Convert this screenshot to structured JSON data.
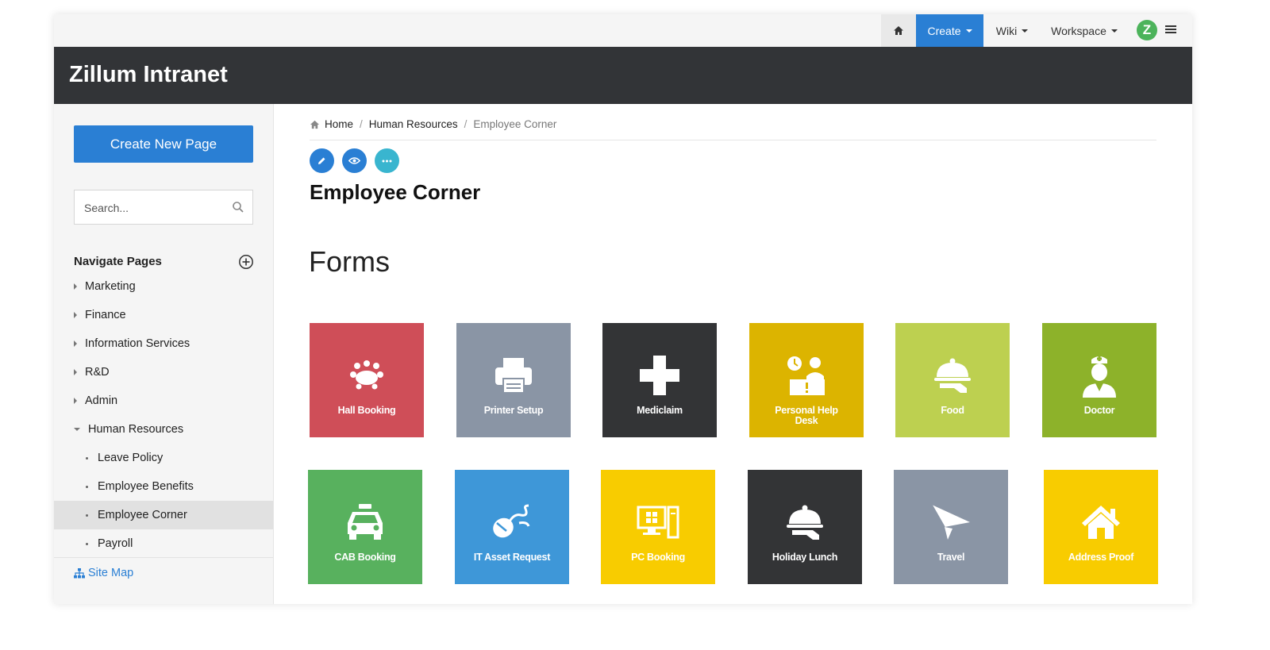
{
  "topnav": {
    "create_label": "Create",
    "wiki_label": "Wiki",
    "workspace_label": "Workspace",
    "avatar_letter": "Z",
    "icons": {
      "home": "home-icon",
      "menu": "hamburger-menu-icon"
    },
    "accent_color": "#2a7fd4"
  },
  "banner": {
    "title": "Zillum Intranet",
    "bg_color": "#323437"
  },
  "sidebar": {
    "create_button": "Create New Page",
    "search_placeholder": "Search...",
    "nav_heading": "Navigate Pages",
    "items": [
      {
        "label": "Marketing"
      },
      {
        "label": "Finance"
      },
      {
        "label": "Information Services"
      },
      {
        "label": "R&D"
      },
      {
        "label": "Admin"
      },
      {
        "label": "Human Resources",
        "expanded": true
      },
      {
        "label": "Leave Policy"
      },
      {
        "label": "Employee Benefits"
      },
      {
        "label": "Employee Corner",
        "active": true
      },
      {
        "label": "Payroll"
      }
    ],
    "sitemap_label": "Site Map"
  },
  "breadcrumb": [
    "Home",
    "Human Resources",
    "Employee Corner"
  ],
  "page": {
    "title": "Employee Corner",
    "section_title": "Forms",
    "action_icons": [
      "edit-icon",
      "view-icon",
      "more-icon"
    ]
  },
  "tiles": [
    {
      "label": "Hall Booking",
      "color": "#cf4e58",
      "icon": "conference-hall-icon"
    },
    {
      "label": "Printer Setup",
      "color": "#8a95a5",
      "icon": "printer-icon"
    },
    {
      "label": "Mediclaim",
      "color": "#333436",
      "icon": "medical-cross-icon"
    },
    {
      "label": "Personal Help Desk",
      "color": "#dcb400",
      "icon": "help-desk-icon"
    },
    {
      "label": "Food",
      "color": "#bdd050",
      "icon": "food-cloche-icon"
    },
    {
      "label": "Doctor",
      "color": "#8db22a",
      "icon": "nurse-icon"
    },
    {
      "label": "CAB Booking",
      "color": "#58b15e",
      "icon": "taxi-icon"
    },
    {
      "label": "IT Asset Request",
      "color": "#3e97d8",
      "icon": "mouse-icon"
    },
    {
      "label": "PC Booking",
      "color": "#f8cc00",
      "icon": "computer-icon"
    },
    {
      "label": "Holiday Lunch",
      "color": "#333436",
      "icon": "lunch-cloche-icon"
    },
    {
      "label": "Travel",
      "color": "#8a95a5",
      "icon": "paper-plane-icon"
    },
    {
      "label": "Address Proof",
      "color": "#f8cc00",
      "icon": "house-icon"
    }
  ]
}
